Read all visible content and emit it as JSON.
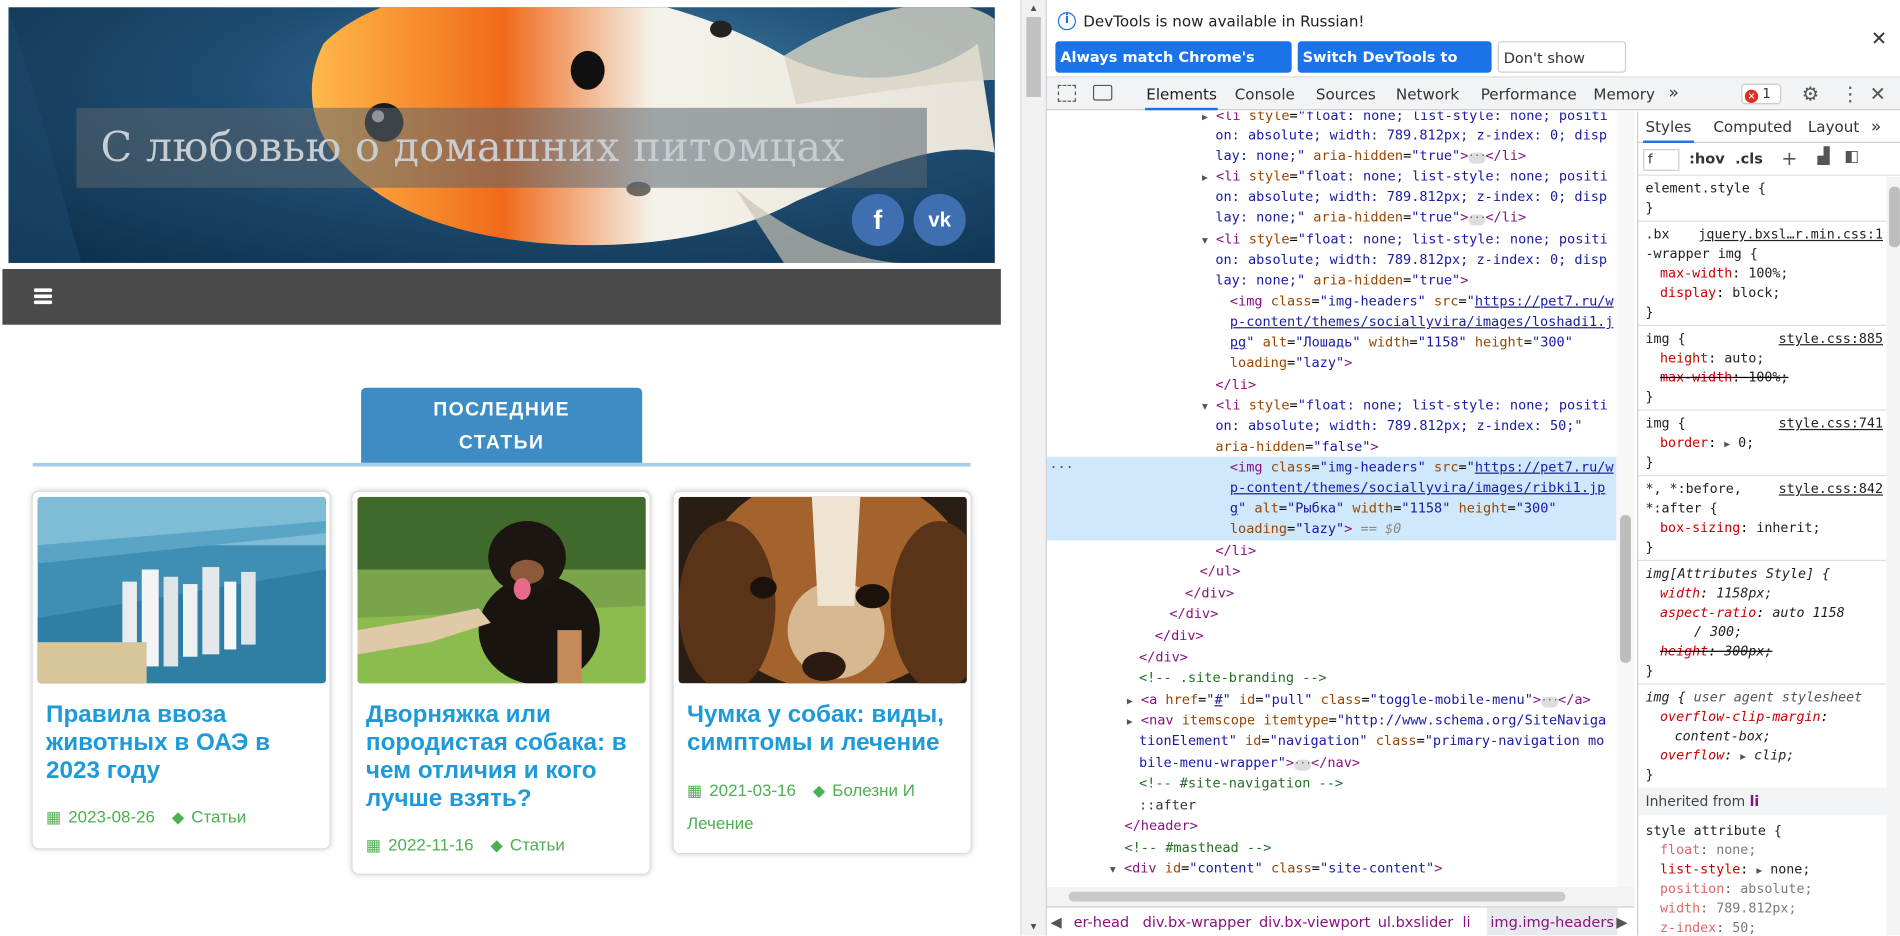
{
  "site": {
    "hero_title": "С любовью о домашних питомцах",
    "social": {
      "facebook": "f",
      "vk": "vk"
    },
    "section_title_1": "ПОСЛЕДНИЕ",
    "section_title_2": "СТАТЬИ",
    "cards": [
      {
        "title": "Правила ввоза животных в ОАЭ в 2023 году",
        "date": "2023-08-26",
        "category": "Статьи"
      },
      {
        "title": "Дворняжка или породистая собака: в чем отличия и кого лучше взять?",
        "date": "2022-11-16",
        "category": "Статьи"
      },
      {
        "title": "Чумка у собак: виды, симптомы и лечение",
        "date": "2021-03-16",
        "category": "Болезни И Лечение"
      }
    ]
  },
  "devtools": {
    "info_text": "DevTools is now available in Russian!",
    "btn_match": "Always match Chrome's language",
    "btn_switch": "Switch DevTools to Russian",
    "btn_dont": "Don't show again",
    "tabs": [
      "Elements",
      "Console",
      "Sources",
      "Network",
      "Performance",
      "Memory"
    ],
    "error_count": "1",
    "side_tabs": [
      "Styles",
      "Computed",
      "Layout"
    ],
    "filter_value": "f",
    "filter_hov": ":hov",
    "filter_cls": ".cls",
    "breadcrumbs": [
      "er-head",
      "div.bx-wrapper",
      "div.bx-viewport",
      "ul.bxslider",
      "li",
      "img.img-headers"
    ],
    "inherited_label": "Inherited from",
    "inherited_el": "li"
  },
  "colors": {
    "accent": "#1a73e8",
    "site_blue": "#3f8cc4",
    "link": "#1e9ad8",
    "meta_green": "#4caf50"
  }
}
